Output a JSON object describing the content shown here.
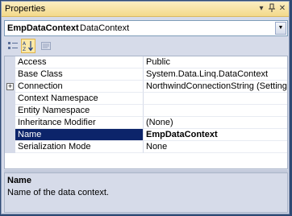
{
  "panel": {
    "title": "Properties",
    "icons": [
      "dropdown-arrow-icon",
      "pin-icon",
      "close-icon"
    ]
  },
  "object_selector": {
    "name": "EmpDataContext",
    "type": "DataContext"
  },
  "toolbar": {
    "buttons": [
      "categorized-icon",
      "alphabetical-icon",
      "property-pages-icon"
    ]
  },
  "properties": [
    {
      "name": "Access",
      "value": "Public"
    },
    {
      "name": "Base Class",
      "value": "System.Data.Linq.DataContext"
    },
    {
      "name": "Connection",
      "value": "NorthwindConnectionString (Settings)",
      "expandable": true
    },
    {
      "name": "Context Namespace",
      "value": ""
    },
    {
      "name": "Entity Namespace",
      "value": ""
    },
    {
      "name": "Inheritance Modifier",
      "value": "(None)"
    },
    {
      "name": "Name",
      "value": "EmpDataContext",
      "selected": true
    },
    {
      "name": "Serialization Mode",
      "value": "None"
    }
  ],
  "description": {
    "title": "Name",
    "text": "Name of the data context."
  }
}
